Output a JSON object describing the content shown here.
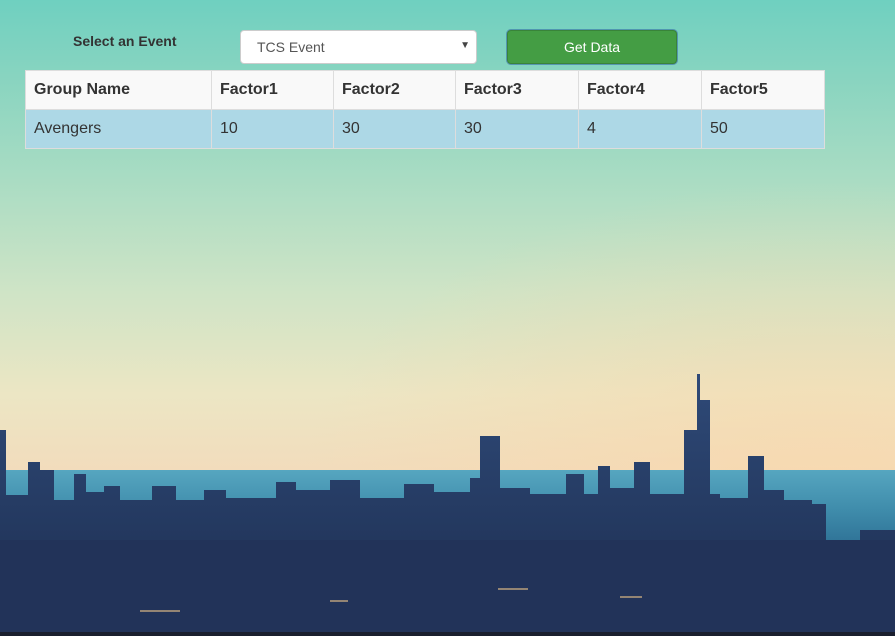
{
  "form": {
    "label": "Select an Event",
    "select_value": "TCS Event",
    "select_arrow": "▼",
    "button_label": "Get Data"
  },
  "table": {
    "headers": [
      "Group Name",
      "Factor1",
      "Factor2",
      "Factor3",
      "Factor4",
      "Factor5"
    ],
    "rows": [
      [
        "Avengers",
        "10",
        "30",
        "30",
        "4",
        "50"
      ]
    ]
  },
  "colors": {
    "button": "#449d44",
    "row_highlight": "#add8e6"
  },
  "background": "city-skyline-image"
}
